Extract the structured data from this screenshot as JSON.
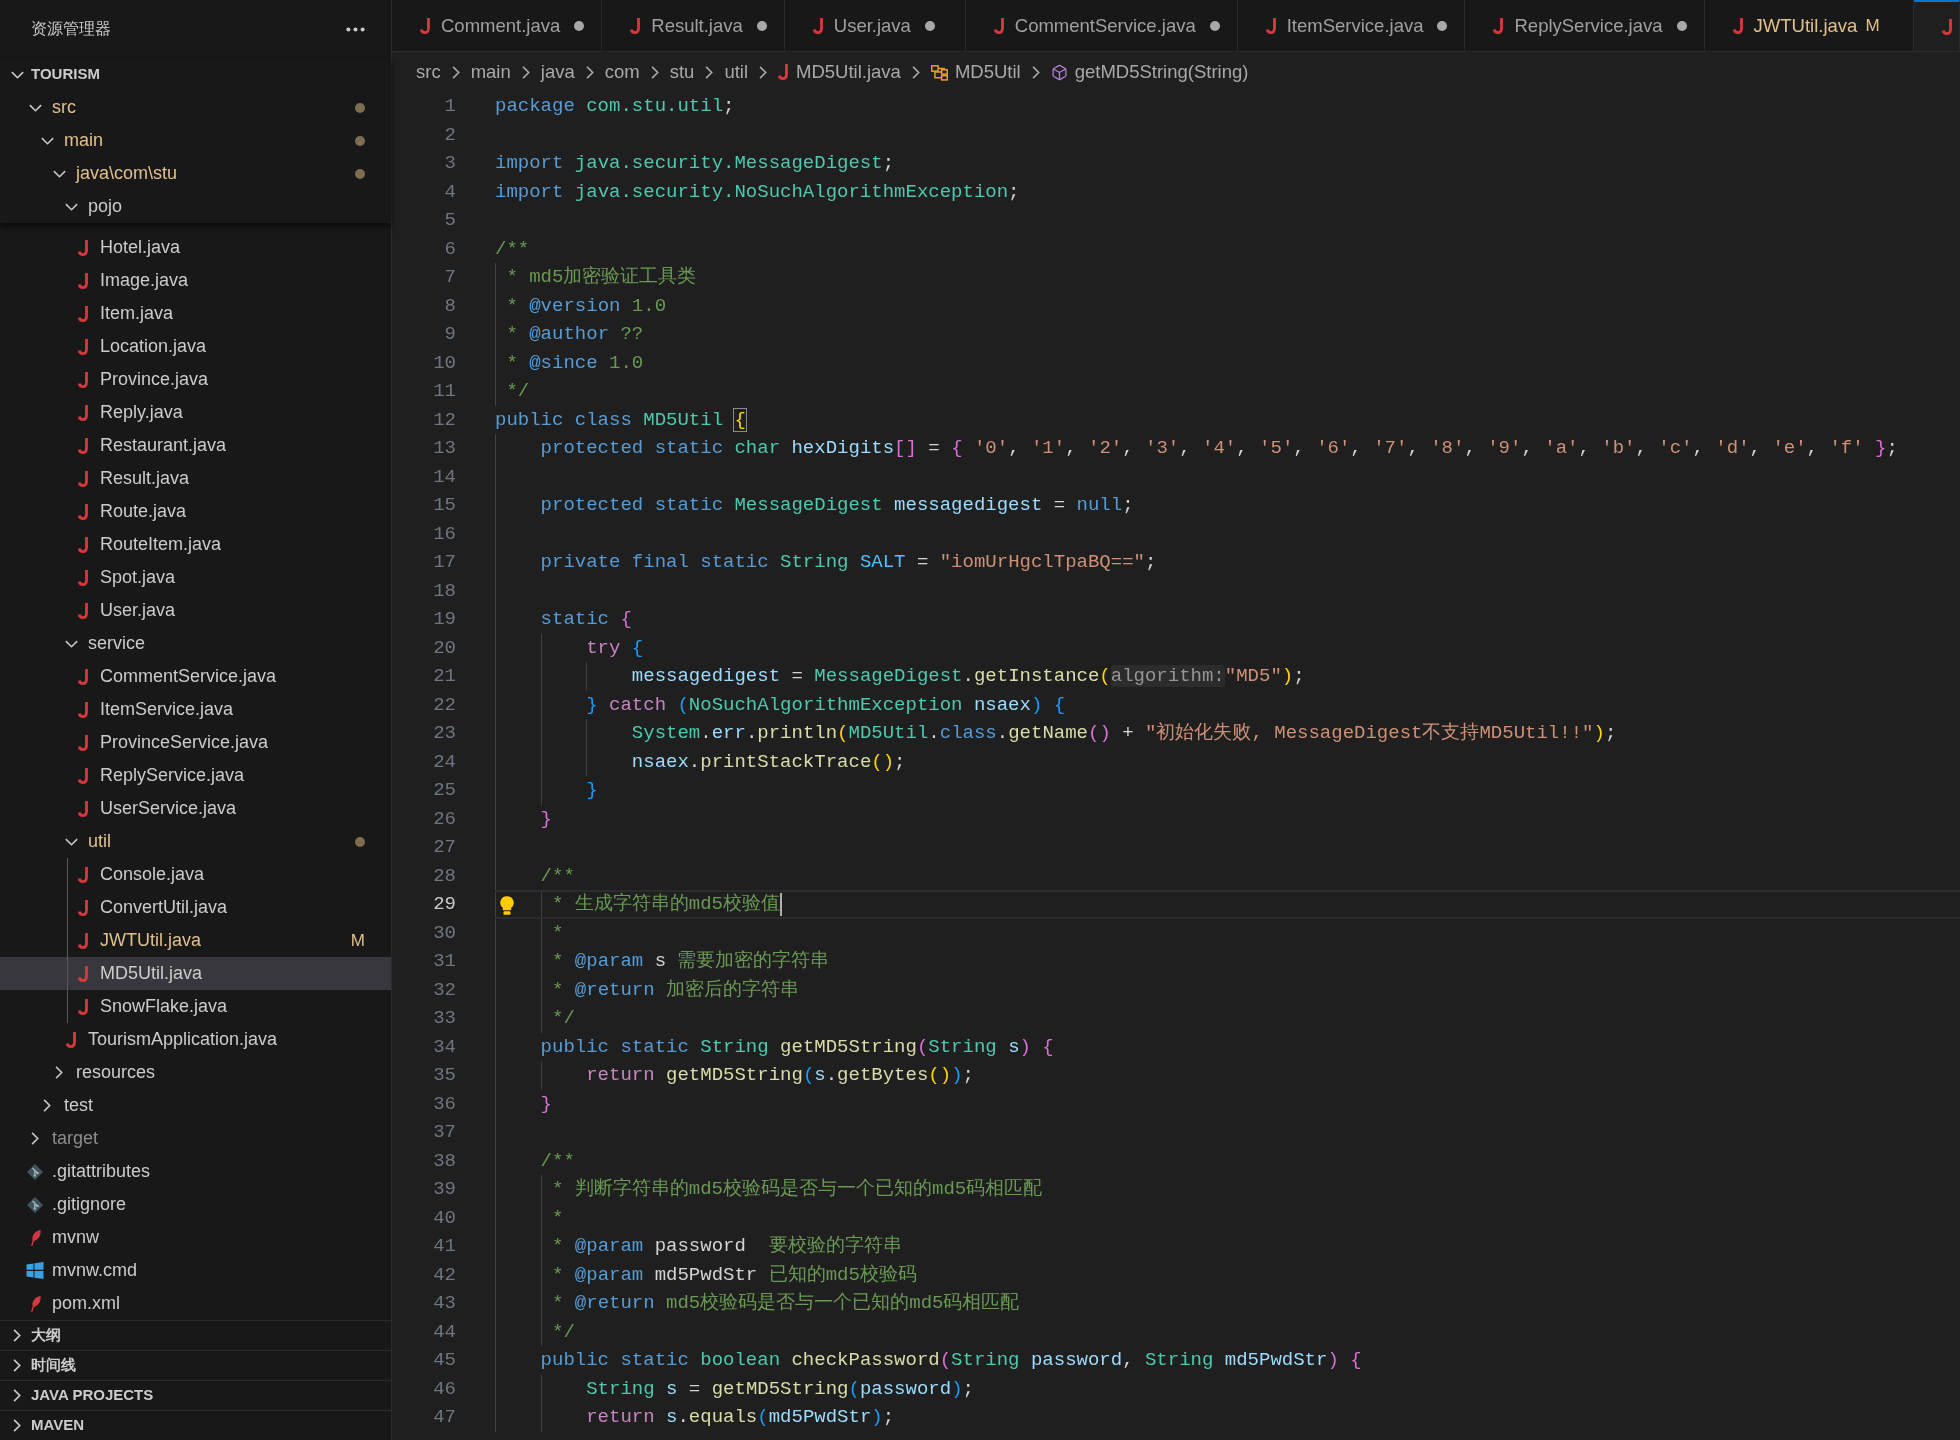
{
  "explorer": {
    "title": "资源管理器",
    "sections": [
      {
        "label": "TOURISM",
        "expanded": true,
        "children": [
          {
            "label": "src",
            "kind": "folder",
            "expanded": true,
            "pinned": true,
            "modified": true,
            "selected": false,
            "children": [
              {
                "label": "main",
                "kind": "folder",
                "expanded": true,
                "pinned": true,
                "modified": true,
                "selected": false,
                "children": [
                  {
                    "label": "java\\com\\stu",
                    "kind": "folder",
                    "expanded": true,
                    "pinned": true,
                    "modified": true,
                    "selected": false,
                    "children": [
                      {
                        "label": "pojo",
                        "kind": "folder",
                        "expanded": true,
                        "pinned": true,
                        "selected": false,
                        "children": [
                          {
                            "label": "Hotel.java",
                            "kind": "java_file",
                            "selected": false
                          },
                          {
                            "label": "Image.java",
                            "kind": "java_file",
                            "selected": false
                          },
                          {
                            "label": "Item.java",
                            "kind": "java_file",
                            "selected": false
                          },
                          {
                            "label": "Location.java",
                            "kind": "java_file",
                            "selected": false
                          },
                          {
                            "label": "Province.java",
                            "kind": "java_file",
                            "selected": false
                          },
                          {
                            "label": "Reply.java",
                            "kind": "java_file",
                            "selected": false
                          },
                          {
                            "label": "Restaurant.java",
                            "kind": "java_file",
                            "selected": false
                          },
                          {
                            "label": "Result.java",
                            "kind": "java_file",
                            "selected": false
                          },
                          {
                            "label": "Route.java",
                            "kind": "java_file",
                            "selected": false
                          },
                          {
                            "label": "RouteItem.java",
                            "kind": "java_file",
                            "selected": false
                          },
                          {
                            "label": "Spot.java",
                            "kind": "java_file",
                            "selected": false
                          },
                          {
                            "label": "User.java",
                            "kind": "java_file",
                            "selected": false
                          }
                        ]
                      },
                      {
                        "label": "service",
                        "kind": "folder",
                        "expanded": true,
                        "selected": false,
                        "children": [
                          {
                            "label": "CommentService.java",
                            "kind": "java_file",
                            "selected": false
                          },
                          {
                            "label": "ItemService.java",
                            "kind": "java_file",
                            "selected": false
                          },
                          {
                            "label": "ProvinceService.java",
                            "kind": "java_file",
                            "selected": false
                          },
                          {
                            "label": "ReplyService.java",
                            "kind": "java_file",
                            "selected": false
                          },
                          {
                            "label": "UserService.java",
                            "kind": "java_file",
                            "selected": false
                          }
                        ]
                      },
                      {
                        "label": "util",
                        "kind": "folder",
                        "expanded": true,
                        "modified": true,
                        "selected": false,
                        "children": [
                          {
                            "label": "Console.java",
                            "kind": "java_file",
                            "selected": false
                          },
                          {
                            "label": "ConvertUtil.java",
                            "kind": "java_file",
                            "selected": false
                          },
                          {
                            "label": "JWTUtil.java",
                            "kind": "java_file",
                            "modified": true,
                            "badge": "M",
                            "selected": false
                          },
                          {
                            "label": "MD5Util.java",
                            "kind": "java_file",
                            "selected": true
                          },
                          {
                            "label": "SnowFlake.java",
                            "kind": "java_file",
                            "selected": false
                          }
                        ]
                      },
                      {
                        "label": "TourismApplication.java",
                        "kind": "java_file",
                        "selected": false
                      }
                    ]
                  },
                  {
                    "label": "resources",
                    "kind": "folder",
                    "expanded": false,
                    "selected": false
                  }
                ]
              },
              {
                "label": "test",
                "kind": "folder",
                "expanded": false,
                "selected": false
              }
            ]
          },
          {
            "label": "target",
            "kind": "folder",
            "expanded": false,
            "ignored": true,
            "selected": false
          },
          {
            "label": ".gitattributes",
            "kind": "git_file",
            "selected": false
          },
          {
            "label": ".gitignore",
            "kind": "git_file",
            "selected": false
          },
          {
            "label": "mvnw",
            "kind": "maven_file",
            "selected": false
          },
          {
            "label": "mvnw.cmd",
            "kind": "windows_file",
            "selected": false
          },
          {
            "label": "pom.xml",
            "kind": "maven_file",
            "selected": false
          }
        ]
      },
      {
        "label": "大纲",
        "expanded": false
      },
      {
        "label": "时间线",
        "expanded": false
      },
      {
        "label": "JAVA PROJECTS",
        "expanded": false
      },
      {
        "label": "MAVEN",
        "expanded": false
      }
    ]
  },
  "tabs": [
    {
      "label": "Comment.java",
      "kind": "java_file",
      "dirty": true,
      "selected": false
    },
    {
      "label": "Result.java",
      "kind": "java_file",
      "dirty": true,
      "selected": false
    },
    {
      "label": "User.java",
      "kind": "java_file",
      "dirty": true,
      "selected": false
    },
    {
      "label": "CommentService.java",
      "kind": "java_file",
      "dirty": true,
      "selected": false
    },
    {
      "label": "ItemService.java",
      "kind": "java_file",
      "dirty": true,
      "selected": false
    },
    {
      "label": "ReplyService.java",
      "kind": "java_file",
      "dirty": true,
      "selected": false
    },
    {
      "label": "JWTUtil.java",
      "kind": "java_file",
      "modified": true,
      "badge": "M",
      "selected": false
    },
    {
      "kind": "java_file",
      "selected": true
    }
  ],
  "breadcrumbs": [
    {
      "label": "src",
      "kind": "folder"
    },
    {
      "label": "main",
      "kind": "folder"
    },
    {
      "label": "java",
      "kind": "folder"
    },
    {
      "label": "com",
      "kind": "folder"
    },
    {
      "label": "stu",
      "kind": "folder"
    },
    {
      "label": "util",
      "kind": "folder"
    },
    {
      "label": "MD5Util.java",
      "kind": "java_file"
    },
    {
      "label": "MD5Util",
      "kind": "class"
    },
    {
      "label": "getMD5String(String)",
      "kind": "method"
    }
  ],
  "editor": {
    "lines": [
      {
        "number": "1",
        "current": false,
        "tokens": [
          {
            "kind": "kw",
            "text": "package "
          },
          {
            "kind": "type",
            "text": "com.stu.util"
          },
          {
            "kind": "punct",
            "text": ";"
          }
        ]
      },
      {
        "number": "2",
        "current": false
      },
      {
        "number": "3",
        "current": false,
        "tokens": [
          {
            "kind": "kw",
            "text": "import "
          },
          {
            "kind": "type",
            "text": "java.security.MessageDigest"
          },
          {
            "kind": "punct",
            "text": ";"
          }
        ]
      },
      {
        "number": "4",
        "current": false,
        "tokens": [
          {
            "kind": "kw",
            "text": "import "
          },
          {
            "kind": "type",
            "text": "java.security.NoSuchAlgorithmException"
          },
          {
            "kind": "punct",
            "text": ";"
          }
        ]
      },
      {
        "number": "5",
        "current": false
      },
      {
        "number": "6",
        "current": false,
        "tokens": [
          {
            "kind": "cmt",
            "text": "/**"
          }
        ]
      },
      {
        "number": "7",
        "current": false,
        "tokens": [
          {
            "kind": "cmt",
            "text": " * md5加密验证工具类"
          }
        ]
      },
      {
        "number": "8",
        "current": false,
        "tokens": [
          {
            "kind": "cmt",
            "text": " * "
          },
          {
            "kind": "tag",
            "text": "@version"
          },
          {
            "kind": "cmt",
            "text": " 1.0"
          }
        ]
      },
      {
        "number": "9",
        "current": false,
        "tokens": [
          {
            "kind": "cmt",
            "text": " * "
          },
          {
            "kind": "tag",
            "text": "@author"
          },
          {
            "kind": "cmt",
            "text": " ??"
          }
        ]
      },
      {
        "number": "10",
        "current": false,
        "tokens": [
          {
            "kind": "cmt",
            "text": " * "
          },
          {
            "kind": "tag",
            "text": "@since"
          },
          {
            "kind": "cmt",
            "text": " 1.0"
          }
        ]
      },
      {
        "number": "11",
        "current": false,
        "tokens": [
          {
            "kind": "cmt",
            "text": " */"
          }
        ]
      },
      {
        "number": "12",
        "current": false,
        "tokens": [
          {
            "kind": "kw",
            "text": "public class "
          },
          {
            "kind": "type",
            "text": "MD5Util "
          },
          {
            "kind": "br1_match",
            "text": "{"
          }
        ]
      },
      {
        "number": "13",
        "current": false,
        "tokens": [
          {
            "kind": "kw",
            "text": "    protected static "
          },
          {
            "kind": "type",
            "text": "char "
          },
          {
            "kind": "var",
            "text": "hexDigits"
          },
          {
            "kind": "br2",
            "text": "[]"
          },
          {
            "kind": "punct",
            "text": " = "
          },
          {
            "kind": "br2",
            "text": "{ "
          },
          {
            "kind": "str",
            "text": "'0'"
          },
          {
            "kind": "punct",
            "text": ", "
          },
          {
            "kind": "str",
            "text": "'1'"
          },
          {
            "kind": "punct",
            "text": ", "
          },
          {
            "kind": "str",
            "text": "'2'"
          },
          {
            "kind": "punct",
            "text": ", "
          },
          {
            "kind": "str",
            "text": "'3'"
          },
          {
            "kind": "punct",
            "text": ", "
          },
          {
            "kind": "str",
            "text": "'4'"
          },
          {
            "kind": "punct",
            "text": ", "
          },
          {
            "kind": "str",
            "text": "'5'"
          },
          {
            "kind": "punct",
            "text": ", "
          },
          {
            "kind": "str",
            "text": "'6'"
          },
          {
            "kind": "punct",
            "text": ", "
          },
          {
            "kind": "str",
            "text": "'7'"
          },
          {
            "kind": "punct",
            "text": ", "
          },
          {
            "kind": "str",
            "text": "'8'"
          },
          {
            "kind": "punct",
            "text": ", "
          },
          {
            "kind": "str",
            "text": "'9'"
          },
          {
            "kind": "punct",
            "text": ", "
          },
          {
            "kind": "str",
            "text": "'a'"
          },
          {
            "kind": "punct",
            "text": ", "
          },
          {
            "kind": "str",
            "text": "'b'"
          },
          {
            "kind": "punct",
            "text": ", "
          },
          {
            "kind": "str",
            "text": "'c'"
          },
          {
            "kind": "punct",
            "text": ", "
          },
          {
            "kind": "str",
            "text": "'d'"
          },
          {
            "kind": "punct",
            "text": ", "
          },
          {
            "kind": "str",
            "text": "'e'"
          },
          {
            "kind": "punct",
            "text": ", "
          },
          {
            "kind": "str",
            "text": "'f'"
          },
          {
            "kind": "br2",
            "text": " }"
          },
          {
            "kind": "punct",
            "text": ";"
          }
        ]
      },
      {
        "number": "14",
        "current": false
      },
      {
        "number": "15",
        "current": false,
        "tokens": [
          {
            "kind": "kw",
            "text": "    protected static "
          },
          {
            "kind": "type",
            "text": "MessageDigest "
          },
          {
            "kind": "var",
            "text": "messagedigest"
          },
          {
            "kind": "punct",
            "text": " = "
          },
          {
            "kind": "kw",
            "text": "null"
          },
          {
            "kind": "punct",
            "text": ";"
          }
        ]
      },
      {
        "number": "16",
        "current": false
      },
      {
        "number": "17",
        "current": false,
        "tokens": [
          {
            "kind": "kw",
            "text": "    private final static "
          },
          {
            "kind": "type",
            "text": "String "
          },
          {
            "kind": "const",
            "text": "SALT"
          },
          {
            "kind": "punct",
            "text": " = "
          },
          {
            "kind": "str",
            "text": "\"iomUrHgclTpaBQ==\""
          },
          {
            "kind": "punct",
            "text": ";"
          }
        ]
      },
      {
        "number": "18",
        "current": false
      },
      {
        "number": "19",
        "current": false,
        "tokens": [
          {
            "kind": "kw",
            "text": "    static "
          },
          {
            "kind": "br2",
            "text": "{"
          }
        ]
      },
      {
        "number": "20",
        "current": false,
        "tokens": [
          {
            "kind": "ctl",
            "text": "        try "
          },
          {
            "kind": "br3",
            "text": "{"
          }
        ]
      },
      {
        "number": "21",
        "current": false,
        "tokens": [
          {
            "kind": "var",
            "text": "            messagedigest"
          },
          {
            "kind": "punct",
            "text": " = "
          },
          {
            "kind": "type",
            "text": "MessageDigest"
          },
          {
            "kind": "punct",
            "text": "."
          },
          {
            "kind": "fn",
            "text": "getInstance"
          },
          {
            "kind": "br1",
            "text": "("
          },
          {
            "kind": "hint",
            "text": "algorithm:"
          },
          {
            "kind": "str",
            "text": "\"MD5\""
          },
          {
            "kind": "br1",
            "text": ")"
          },
          {
            "kind": "punct",
            "text": ";"
          }
        ]
      },
      {
        "number": "22",
        "current": false,
        "tokens": [
          {
            "kind": "br3",
            "text": "        } "
          },
          {
            "kind": "ctl",
            "text": "catch "
          },
          {
            "kind": "br3",
            "text": "("
          },
          {
            "kind": "type",
            "text": "NoSuchAlgorithmException "
          },
          {
            "kind": "var",
            "text": "nsaex"
          },
          {
            "kind": "br3",
            "text": ") {"
          }
        ]
      },
      {
        "number": "23",
        "current": false,
        "tokens": [
          {
            "kind": "type",
            "text": "            System"
          },
          {
            "kind": "punct",
            "text": "."
          },
          {
            "kind": "var",
            "text": "err"
          },
          {
            "kind": "punct",
            "text": "."
          },
          {
            "kind": "fn",
            "text": "println"
          },
          {
            "kind": "br1",
            "text": "("
          },
          {
            "kind": "type",
            "text": "MD5Util"
          },
          {
            "kind": "punct",
            "text": "."
          },
          {
            "kind": "kw",
            "text": "class"
          },
          {
            "kind": "punct",
            "text": "."
          },
          {
            "kind": "fn",
            "text": "getName"
          },
          {
            "kind": "br2",
            "text": "()"
          },
          {
            "kind": "punct",
            "text": " + "
          },
          {
            "kind": "str",
            "text": "\"初始化失败, MessageDigest不支持MD5Util!!\""
          },
          {
            "kind": "br1",
            "text": ")"
          },
          {
            "kind": "punct",
            "text": ";"
          }
        ]
      },
      {
        "number": "24",
        "current": false,
        "tokens": [
          {
            "kind": "var",
            "text": "            nsaex"
          },
          {
            "kind": "punct",
            "text": "."
          },
          {
            "kind": "fn",
            "text": "printStackTrace"
          },
          {
            "kind": "br1",
            "text": "()"
          },
          {
            "kind": "punct",
            "text": ";"
          }
        ]
      },
      {
        "number": "25",
        "current": false,
        "tokens": [
          {
            "kind": "br3",
            "text": "        }"
          }
        ]
      },
      {
        "number": "26",
        "current": false,
        "tokens": [
          {
            "kind": "br2",
            "text": "    }"
          }
        ]
      },
      {
        "number": "27",
        "current": false
      },
      {
        "number": "28",
        "current": false,
        "tokens": [
          {
            "kind": "cmt",
            "text": "    /**"
          }
        ]
      },
      {
        "number": "29",
        "current": true,
        "cursor": true,
        "lightbulb": true,
        "tokens": [
          {
            "kind": "cmt",
            "text": "     * 生成字符串的md5校验值"
          }
        ]
      },
      {
        "number": "30",
        "current": false,
        "tokens": [
          {
            "kind": "cmt",
            "text": "     *"
          }
        ]
      },
      {
        "number": "31",
        "current": false,
        "tokens": [
          {
            "kind": "cmt",
            "text": "     * "
          },
          {
            "kind": "tag",
            "text": "@param"
          },
          {
            "kind": "name",
            "text": " s"
          },
          {
            "kind": "cmt",
            "text": " 需要加密的字符串"
          }
        ]
      },
      {
        "number": "32",
        "current": false,
        "tokens": [
          {
            "kind": "cmt",
            "text": "     * "
          },
          {
            "kind": "tag",
            "text": "@return"
          },
          {
            "kind": "cmt",
            "text": " 加密后的字符串"
          }
        ]
      },
      {
        "number": "33",
        "current": false,
        "tokens": [
          {
            "kind": "cmt",
            "text": "     */"
          }
        ]
      },
      {
        "number": "34",
        "current": false,
        "tokens": [
          {
            "kind": "kw",
            "text": "    public static "
          },
          {
            "kind": "type",
            "text": "String "
          },
          {
            "kind": "fn",
            "text": "getMD5String"
          },
          {
            "kind": "br2",
            "text": "("
          },
          {
            "kind": "type",
            "text": "String "
          },
          {
            "kind": "var",
            "text": "s"
          },
          {
            "kind": "br2",
            "text": ") {"
          }
        ]
      },
      {
        "number": "35",
        "current": false,
        "tokens": [
          {
            "kind": "ctl",
            "text": "        return "
          },
          {
            "kind": "fn",
            "text": "getMD5String"
          },
          {
            "kind": "br3",
            "text": "("
          },
          {
            "kind": "var",
            "text": "s"
          },
          {
            "kind": "punct",
            "text": "."
          },
          {
            "kind": "fn",
            "text": "getBytes"
          },
          {
            "kind": "br1",
            "text": "()"
          },
          {
            "kind": "br3",
            "text": ")"
          },
          {
            "kind": "punct",
            "text": ";"
          }
        ]
      },
      {
        "number": "36",
        "current": false,
        "tokens": [
          {
            "kind": "br2",
            "text": "    }"
          }
        ]
      },
      {
        "number": "37",
        "current": false
      },
      {
        "number": "38",
        "current": false,
        "tokens": [
          {
            "kind": "cmt",
            "text": "    /**"
          }
        ]
      },
      {
        "number": "39",
        "current": false,
        "tokens": [
          {
            "kind": "cmt",
            "text": "     * 判断字符串的md5校验码是否与一个已知的md5码相匹配"
          }
        ]
      },
      {
        "number": "40",
        "current": false,
        "tokens": [
          {
            "kind": "cmt",
            "text": "     *"
          }
        ]
      },
      {
        "number": "41",
        "current": false,
        "tokens": [
          {
            "kind": "cmt",
            "text": "     * "
          },
          {
            "kind": "tag",
            "text": "@param"
          },
          {
            "kind": "name",
            "text": " password"
          },
          {
            "kind": "cmt",
            "text": "  要校验的字符串"
          }
        ]
      },
      {
        "number": "42",
        "current": false,
        "tokens": [
          {
            "kind": "cmt",
            "text": "     * "
          },
          {
            "kind": "tag",
            "text": "@param"
          },
          {
            "kind": "name",
            "text": " md5PwdStr"
          },
          {
            "kind": "cmt",
            "text": " 已知的md5校验码"
          }
        ]
      },
      {
        "number": "43",
        "current": false,
        "tokens": [
          {
            "kind": "cmt",
            "text": "     * "
          },
          {
            "kind": "tag",
            "text": "@return"
          },
          {
            "kind": "cmt",
            "text": " md5校验码是否与一个已知的md5码相匹配"
          }
        ]
      },
      {
        "number": "44",
        "current": false,
        "tokens": [
          {
            "kind": "cmt",
            "text": "     */"
          }
        ]
      },
      {
        "number": "45",
        "current": false,
        "tokens": [
          {
            "kind": "kw",
            "text": "    public static "
          },
          {
            "kind": "type",
            "text": "boolean "
          },
          {
            "kind": "fn",
            "text": "checkPassword"
          },
          {
            "kind": "br2",
            "text": "("
          },
          {
            "kind": "type",
            "text": "String "
          },
          {
            "kind": "var",
            "text": "password"
          },
          {
            "kind": "punct",
            "text": ", "
          },
          {
            "kind": "type",
            "text": "String "
          },
          {
            "kind": "var",
            "text": "md5PwdStr"
          },
          {
            "kind": "br2",
            "text": ") {"
          }
        ]
      },
      {
        "number": "46",
        "current": false,
        "tokens": [
          {
            "kind": "type",
            "text": "        String "
          },
          {
            "kind": "var",
            "text": "s"
          },
          {
            "kind": "punct",
            "text": " = "
          },
          {
            "kind": "fn",
            "text": "getMD5String"
          },
          {
            "kind": "br3",
            "text": "("
          },
          {
            "kind": "var",
            "text": "password"
          },
          {
            "kind": "br3",
            "text": ")"
          },
          {
            "kind": "punct",
            "text": ";"
          }
        ]
      },
      {
        "number": "47",
        "current": false,
        "tokens": [
          {
            "kind": "ctl",
            "text": "        return "
          },
          {
            "kind": "var",
            "text": "s"
          },
          {
            "kind": "punct",
            "text": "."
          },
          {
            "kind": "fn",
            "text": "equals"
          },
          {
            "kind": "br3",
            "text": "("
          },
          {
            "kind": "var",
            "text": "md5PwdStr"
          },
          {
            "kind": "br3",
            "text": ")"
          },
          {
            "kind": "punct",
            "text": ";"
          }
        ]
      }
    ]
  }
}
